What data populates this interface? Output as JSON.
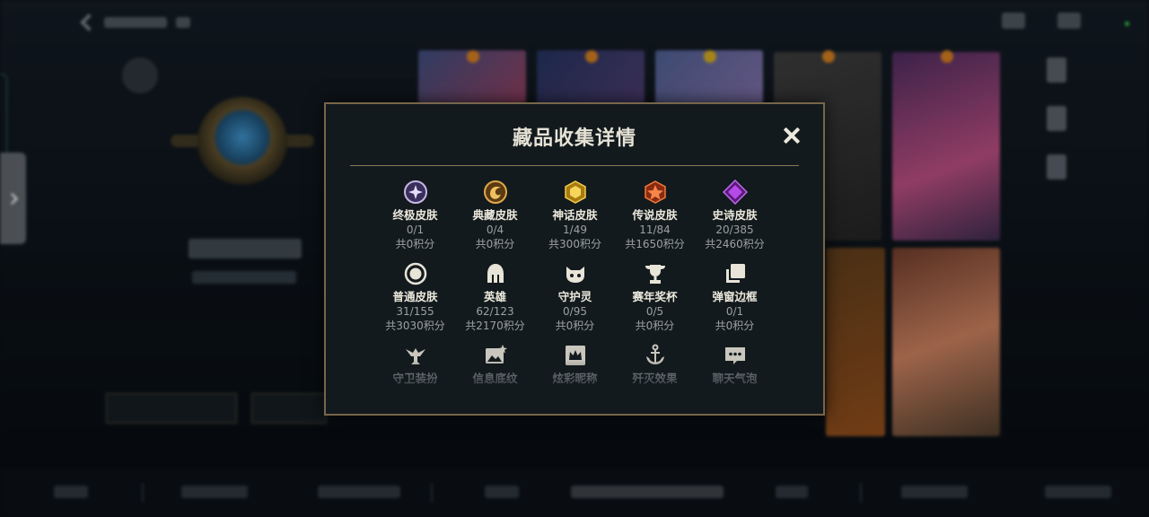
{
  "modal": {
    "title": "藏品收集详情",
    "close_icon": "close-icon",
    "items": [
      {
        "id": "ultimate-skin",
        "icon": "ultimate-skin-icon",
        "name": "终极皮肤",
        "count": "0/1",
        "points": "共0积分"
      },
      {
        "id": "classic-skin",
        "icon": "classic-skin-icon",
        "name": "典藏皮肤",
        "count": "0/4",
        "points": "共0积分"
      },
      {
        "id": "mythic-skin",
        "icon": "mythic-skin-icon",
        "name": "神话皮肤",
        "count": "1/49",
        "points": "共300积分"
      },
      {
        "id": "legendary-skin",
        "icon": "legendary-skin-icon",
        "name": "传说皮肤",
        "count": "11/84",
        "points": "共1650积分"
      },
      {
        "id": "epic-skin",
        "icon": "epic-skin-icon",
        "name": "史诗皮肤",
        "count": "20/385",
        "points": "共2460积分"
      },
      {
        "id": "normal-skin",
        "icon": "normal-skin-icon",
        "name": "普通皮肤",
        "count": "31/155",
        "points": "共3030积分"
      },
      {
        "id": "hero",
        "icon": "helmet-icon",
        "name": "英雄",
        "count": "62/123",
        "points": "共2170积分"
      },
      {
        "id": "guardian-spirit",
        "icon": "guardian-pet-icon",
        "name": "守护灵",
        "count": "0/95",
        "points": "共0积分"
      },
      {
        "id": "season-trophy",
        "icon": "trophy-icon",
        "name": "赛年奖杯",
        "count": "0/5",
        "points": "共0积分"
      },
      {
        "id": "popup-frame",
        "icon": "frame-icon",
        "name": "弹窗边框",
        "count": "0/1",
        "points": "共0积分"
      },
      {
        "id": "guard-outfit",
        "icon": "guard-statue-icon",
        "name": "守卫装扮",
        "count": "",
        "points": ""
      },
      {
        "id": "info-card-pattern",
        "icon": "picture-star-icon",
        "name": "信息底纹",
        "count": "",
        "points": ""
      },
      {
        "id": "colorful-nickname",
        "icon": "crown-card-icon",
        "name": "炫彩昵称",
        "count": "",
        "points": ""
      },
      {
        "id": "kill-effect",
        "icon": "anchor-icon",
        "name": "歼灭效果",
        "count": "",
        "points": ""
      },
      {
        "id": "chat-bubble",
        "icon": "chat-bubble-icon",
        "name": "聊天气泡",
        "count": "",
        "points": ""
      }
    ]
  },
  "colors": {
    "modal_bg": "#121a1d",
    "modal_border": "#77664a",
    "title": "#e6e2d6",
    "subtext": "#9ba1a5",
    "status_online": "#2ebd4a"
  }
}
